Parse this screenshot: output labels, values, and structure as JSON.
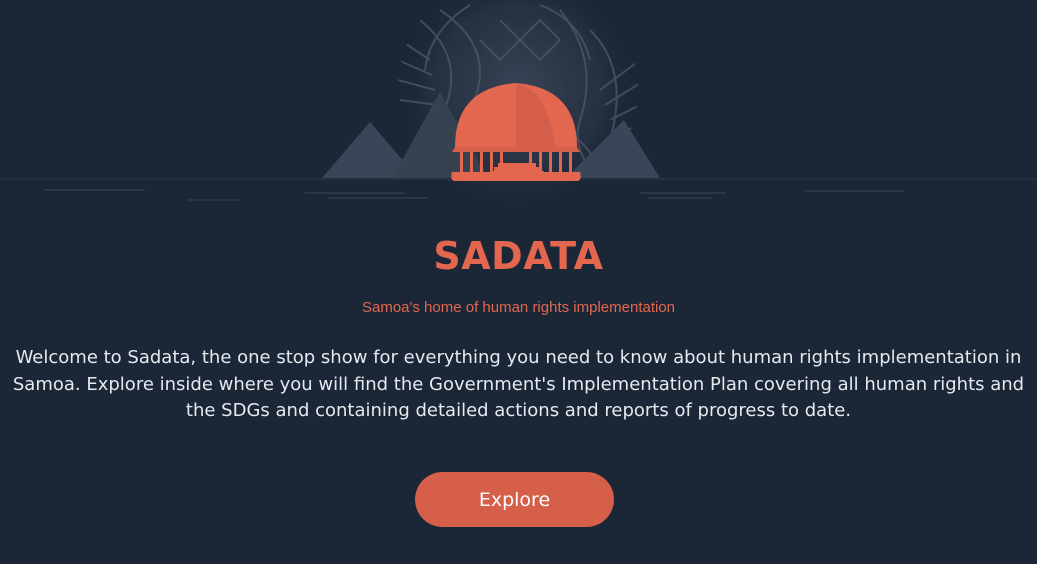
{
  "hero": {
    "illustration_icon": "fale-house-with-mountains-icon",
    "colors": {
      "background": "#1b2637",
      "accent": "#e3674e",
      "mountain": "#3a4657",
      "water_line": "#2f3b4c"
    }
  },
  "header": {
    "title": "SADATA",
    "subtitle": "Samoa's home of human rights implementation"
  },
  "intro": {
    "text": "Welcome to Sadata, the one stop show for everything you need to know about human rights implementation in Samoa. Explore inside where you will find the Government's Implementation Plan covering all human rights and the SDGs and containing detailed actions and reports of progress to date."
  },
  "actions": {
    "explore_label": "Explore"
  }
}
